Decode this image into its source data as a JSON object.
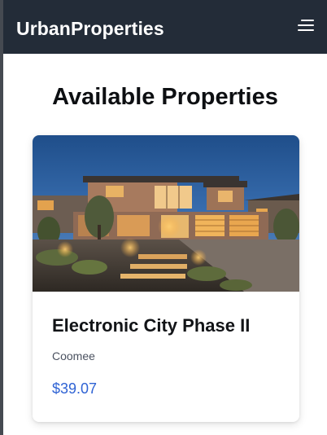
{
  "navbar": {
    "brand": "UrbanProperties",
    "menu_icon": "hamburger-menu-icon"
  },
  "main": {
    "heading": "Available Properties",
    "properties": [
      {
        "title": "Electronic City Phase II",
        "location": "Coomee",
        "price": "$39.07",
        "image": "modern-house-at-dusk"
      }
    ]
  },
  "colors": {
    "navbar_bg": "#232c38",
    "price": "#2f63d4",
    "page_bg": "#ffffff"
  }
}
